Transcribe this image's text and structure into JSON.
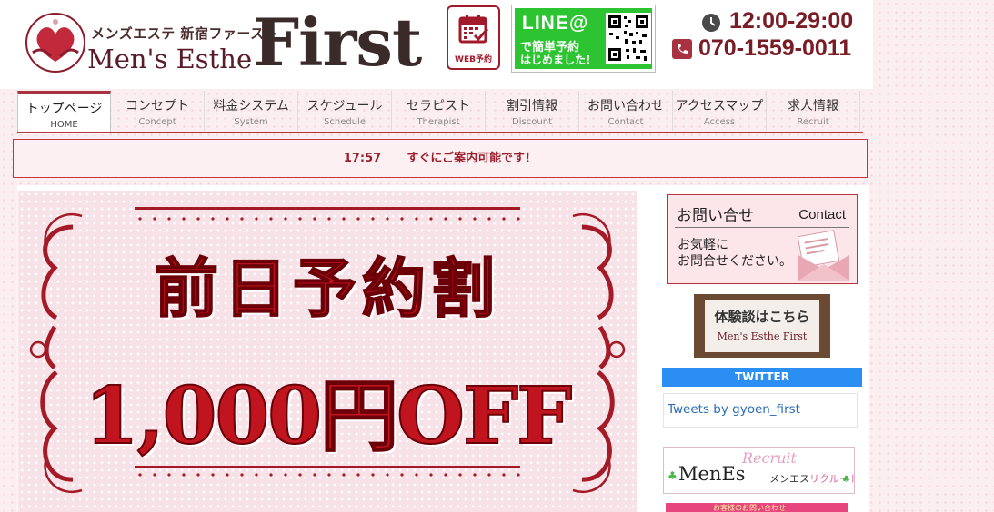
{
  "header": {
    "logo": {
      "subtitle": "メンズエステ 新宿ファースト",
      "name": "Men's Esthe",
      "brand": "First"
    },
    "web_reserve_label": "WEB予約",
    "line": {
      "title": "LINE@",
      "line1": "で簡単予約",
      "line2": "はじめました!"
    },
    "hours": "12:00-29:00",
    "phone": "070-1559-0011",
    "icons": {
      "hours": "clock-icon",
      "phone": "phone-icon",
      "web": "calendar-check-icon",
      "qr": "qr-code-icon"
    },
    "brand_color": "#7a1c25"
  },
  "nav": {
    "items": [
      {
        "jp": "トップページ",
        "en": "HOME",
        "active": true
      },
      {
        "jp": "コンセプト",
        "en": "Concept"
      },
      {
        "jp": "料金システム",
        "en": "System"
      },
      {
        "jp": "スケジュール",
        "en": "Schedule"
      },
      {
        "jp": "セラピスト",
        "en": "Therapist"
      },
      {
        "jp": "割引情報",
        "en": "Discount"
      },
      {
        "jp": "お問い合わせ",
        "en": "Contact"
      },
      {
        "jp": "アクセスマップ",
        "en": "Access"
      },
      {
        "jp": "求人情報",
        "en": "Recruit"
      }
    ],
    "accent_color": "#a8323f"
  },
  "notice": {
    "time": "17:57",
    "message": "すぐにご案内可能です！"
  },
  "banner": {
    "line1": "前日予約割",
    "line2": "1,000円OFF",
    "color": "#c0141e"
  },
  "sidebar": {
    "contact": {
      "title": "お問い合せ",
      "title_en": "Contact",
      "body1": "お気軽に",
      "body2": "お問合せください。"
    },
    "experience": {
      "text": "体験談はこちら",
      "logo": "Men's Esthe First"
    },
    "twitter": {
      "heading": "TWITTER",
      "link": "Tweets by gyoen_first",
      "color": "#2a8ef2"
    },
    "recruit": {
      "script": "Recruit",
      "menes": "MenEs",
      "jp_a": "メンエス",
      "jp_b": "リクルート"
    },
    "promo": {
      "text": "お客様のお問い合わせ"
    }
  }
}
